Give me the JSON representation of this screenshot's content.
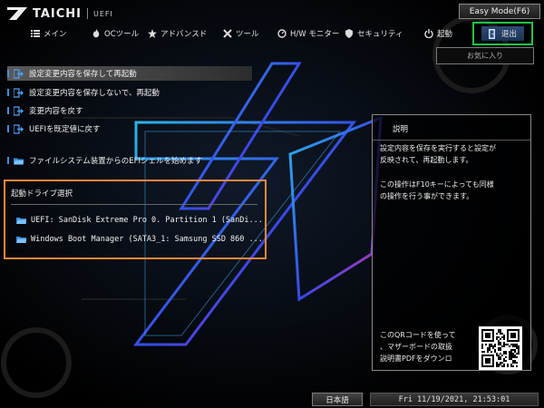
{
  "brand": {
    "name": "TAICHI",
    "sub": "UEFI"
  },
  "easy_mode_label": "Easy Mode(F6)",
  "nav": {
    "main": "メイン",
    "oc": "OCツール",
    "advanced": "アドバンスド",
    "tool": "ツール",
    "hw": "H/W モニター",
    "security": "セキュリティ",
    "boot": "起動",
    "exit": "退出"
  },
  "favorites_label": "お気に入り",
  "menu": {
    "items": [
      {
        "label": "設定変更内容を保存して再起動",
        "icon": "exit-arrow-icon"
      },
      {
        "label": "設定変更内容を保存しないで、再起動",
        "icon": "exit-arrow-icon"
      },
      {
        "label": "変更内容を戻す",
        "icon": "exit-arrow-icon"
      },
      {
        "label": "UEFIを既定値に戻す",
        "icon": "exit-arrow-icon"
      }
    ],
    "efi_shell": {
      "label": "ファイルシステム装置からのEFIシェルを始めます",
      "icon": "folder-icon"
    }
  },
  "boot_override": {
    "title": "起動ドライブ選択",
    "items": [
      {
        "label": "UEFI: SanDisk Extreme Pro 0. Partition 1 (SanDi...",
        "icon": "folder-icon"
      },
      {
        "label": "Windows Boot Manager (SATA3_1: Samsung SSD 860 ...",
        "icon": "folder-icon"
      }
    ]
  },
  "help": {
    "title": "説明",
    "text1": "設定内容を保存を実行すると設定が\n反映されて、再起動します。",
    "text2": "この操作はF10キーによっても同様\nの操作を行う事ができます。",
    "qr_text": "このQRコードを使って\n、マザーボードの取扱\n説明書PDFをダウンロ"
  },
  "status": {
    "language": "日本語",
    "datetime": "Fri 11/19/2021, 21:53:01"
  },
  "colors": {
    "accent_blue": "#3f8fd8",
    "exit_highlight": "#1fc44a",
    "boot_box_border": "#e8893a",
    "selection": "#5a5a5a"
  }
}
